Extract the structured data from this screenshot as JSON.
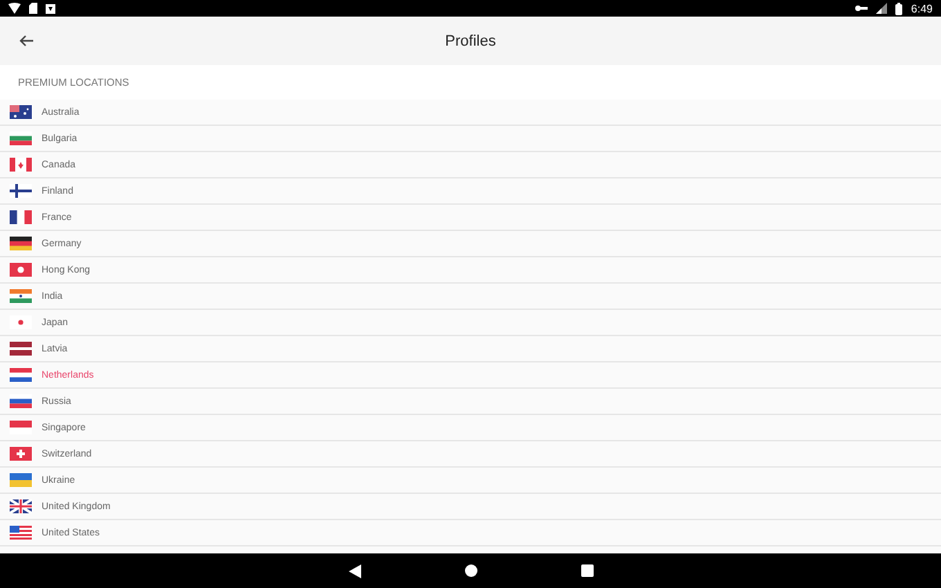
{
  "status_bar": {
    "time": "6:49"
  },
  "toolbar": {
    "title": "Profiles"
  },
  "section": {
    "title": "PREMIUM LOCATIONS"
  },
  "locations": [
    {
      "name": "Australia",
      "kind": "au",
      "selected": false
    },
    {
      "name": "Bulgaria",
      "kind": "bg",
      "selected": false
    },
    {
      "name": "Canada",
      "kind": "ca",
      "selected": false
    },
    {
      "name": "Finland",
      "kind": "fi",
      "selected": false
    },
    {
      "name": "France",
      "kind": "fr",
      "selected": false
    },
    {
      "name": "Germany",
      "kind": "de",
      "selected": false
    },
    {
      "name": "Hong Kong",
      "kind": "hk",
      "selected": false
    },
    {
      "name": "India",
      "kind": "in",
      "selected": false
    },
    {
      "name": "Japan",
      "kind": "jp",
      "selected": false
    },
    {
      "name": "Latvia",
      "kind": "lv",
      "selected": false
    },
    {
      "name": "Netherlands",
      "kind": "nl",
      "selected": true
    },
    {
      "name": "Russia",
      "kind": "ru",
      "selected": false
    },
    {
      "name": "Singapore",
      "kind": "sg",
      "selected": false
    },
    {
      "name": "Switzerland",
      "kind": "ch",
      "selected": false
    },
    {
      "name": "Ukraine",
      "kind": "ua",
      "selected": false
    },
    {
      "name": "United Kingdom",
      "kind": "gb",
      "selected": false
    },
    {
      "name": "United States",
      "kind": "us",
      "selected": false
    }
  ]
}
